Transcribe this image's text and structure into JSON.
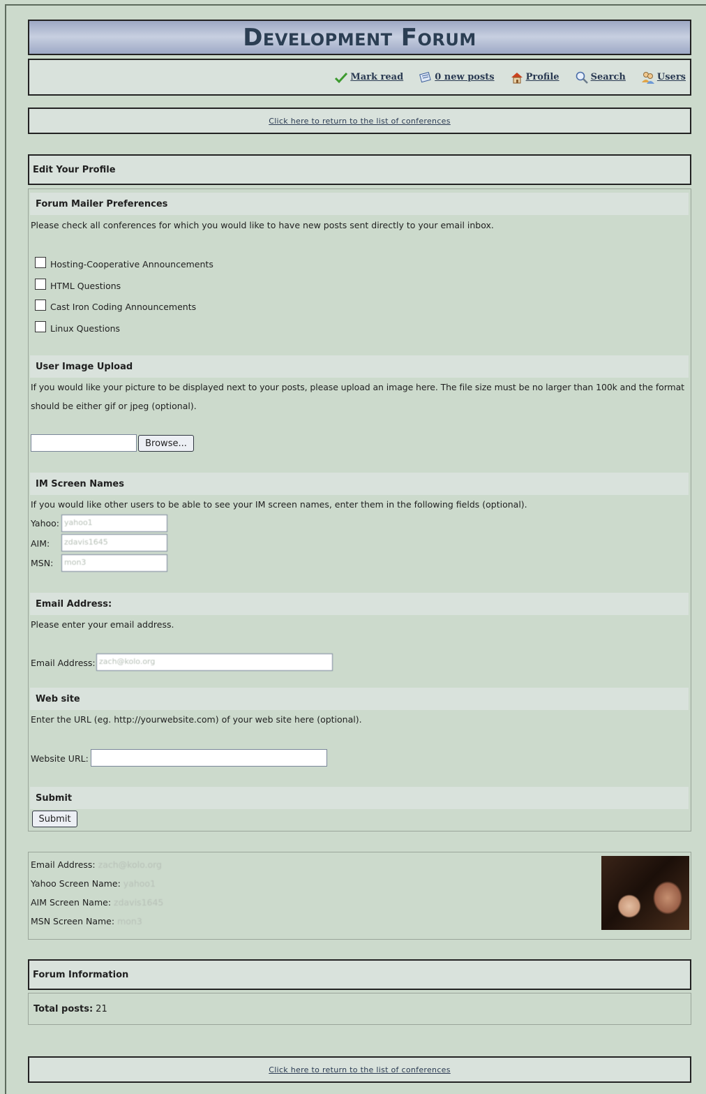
{
  "header": {
    "title": "Development Forum"
  },
  "nav": {
    "items": [
      {
        "label": "Mark read",
        "icon": "checkmark-icon"
      },
      {
        "label": "0 new posts",
        "icon": "new-posts-icon"
      },
      {
        "label": "Profile",
        "icon": "profile-house-icon"
      },
      {
        "label": "Search",
        "icon": "magnifier-icon"
      },
      {
        "label": "Users",
        "icon": "users-icon"
      }
    ]
  },
  "return_link": "Click here to return to the list of conferences",
  "profile": {
    "heading": "Edit Your Profile",
    "mailer": {
      "title": "Forum Mailer Preferences",
      "description": "Please check all conferences for which you would like to have new posts sent directly to your email inbox.",
      "options": [
        {
          "label": "Hosting-Cooperative Announcements",
          "checked": false
        },
        {
          "label": "HTML Questions",
          "checked": false
        },
        {
          "label": "Cast Iron Coding Announcements",
          "checked": false
        },
        {
          "label": "Linux Questions",
          "checked": false
        }
      ]
    },
    "image_upload": {
      "title": "User Image Upload",
      "description_line1": "If you would like your picture to be displayed next to your posts, please upload an image here. The file size must be no larger than 100k and the format",
      "description_line2": "should be either gif or jpeg (optional).",
      "file_value": "",
      "browse_label": "Browse..."
    },
    "im": {
      "title": "IM Screen Names",
      "description": "If you would like other users to be able to see your IM screen names, enter them in the following fields (optional).",
      "yahoo_label": "Yahoo:",
      "yahoo_value": "yahoo1",
      "aim_label": "AIM:",
      "aim_value": "zdavis1645",
      "msn_label": "MSN:",
      "msn_value": "mon3"
    },
    "email": {
      "title": "Email Address:",
      "description": "Please enter your email address.",
      "label": "Email Address:",
      "value": "zach@kolo.org"
    },
    "website": {
      "title": "Web site",
      "description": "Enter the URL (eg. http://yourwebsite.com) of your web site here (optional).",
      "label": "Website URL:",
      "value": ""
    },
    "submit": {
      "title": "Submit",
      "button_label": "Submit"
    }
  },
  "summary": {
    "email_label": "Email Address:",
    "email_value": "zach@kolo.org",
    "yahoo_label": "Yahoo Screen Name:",
    "yahoo_value": "yahoo1",
    "aim_label": "AIM Screen Name:",
    "aim_value": "zdavis1645",
    "msn_label": "MSN Screen Name:",
    "msn_value": "mon3"
  },
  "forum_info": {
    "heading": "Forum Information",
    "total_posts_label": "Total posts:",
    "total_posts_value": "21"
  }
}
